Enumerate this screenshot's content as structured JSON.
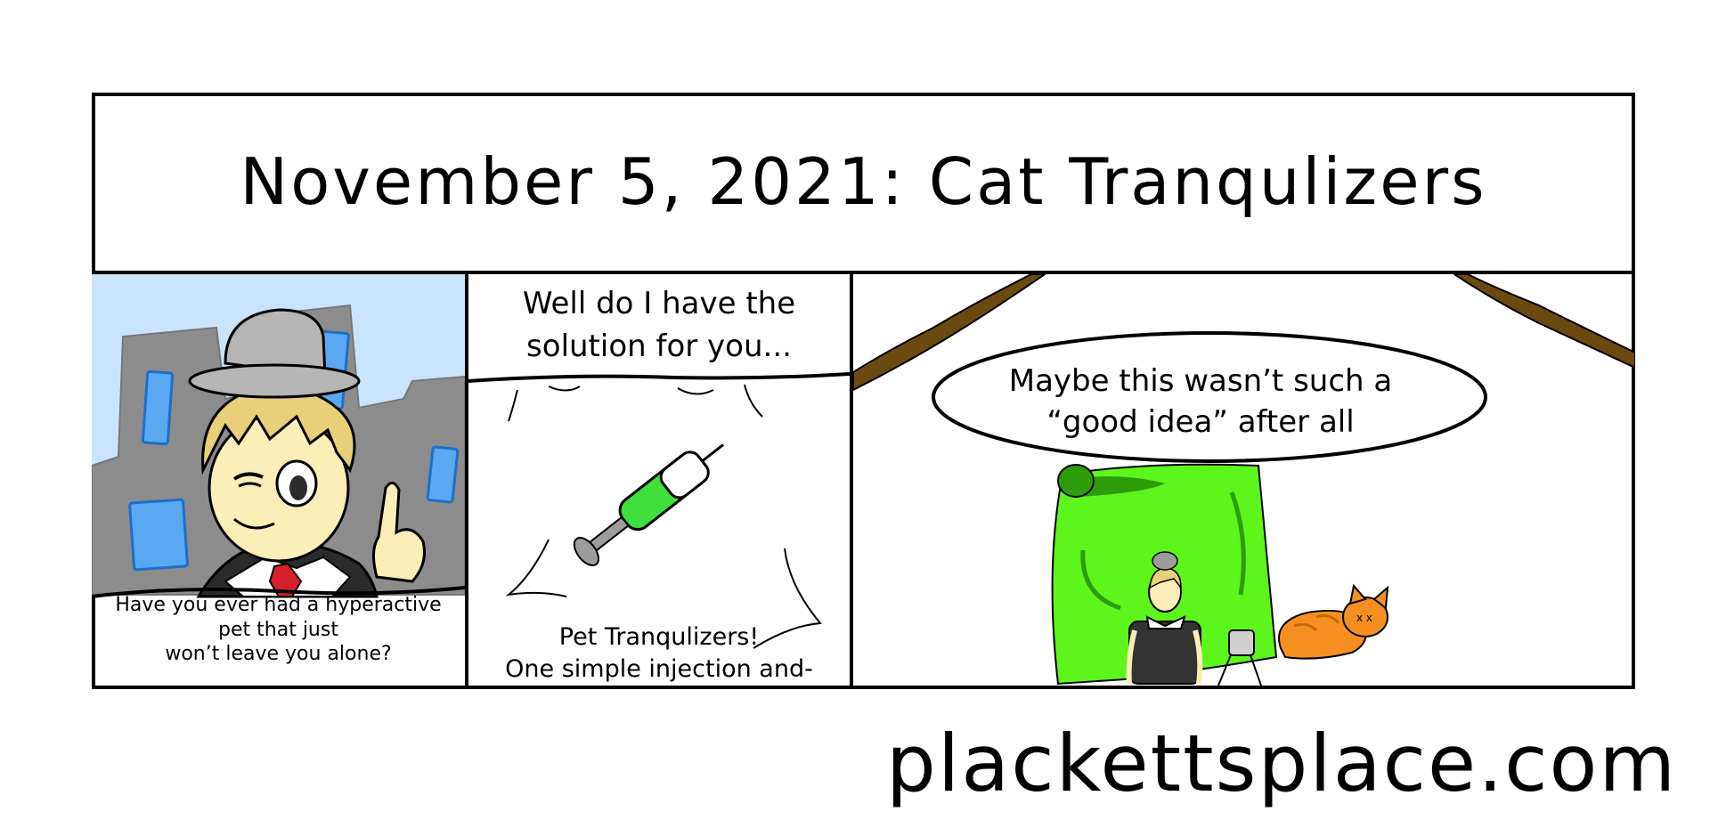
{
  "comic": {
    "title": "November 5, 2021: Cat Tranqulizers",
    "panel_1": {
      "caption_lines": [
        "Have you ever had a hyperactive",
        "pet that just",
        "won’t leave you alone?"
      ]
    },
    "panel_2": {
      "top_caption_lines": [
        "Well do I have the",
        "solution for you..."
      ],
      "bottom_caption_lines": [
        "Pet Tranqulizers!",
        "One simple injection and-"
      ]
    },
    "panel_3": {
      "bubble_lines": [
        "Maybe this wasn’t such a",
        "“good idea” after all"
      ]
    }
  },
  "footer": {
    "site": "plackettsplace.com"
  },
  "colors": {
    "sky": "#c9e3fa",
    "building": "#8c8c8c",
    "window": "#5aa7f2",
    "hat": "#b5b5b5",
    "hair": "#e8cf7a",
    "skin": "#fbefb8",
    "tie": "#d8202a",
    "syringe_fluid": "#3fe03b",
    "curtain": "#5df51b",
    "cat": "#f59020",
    "branch": "#6b4a10"
  }
}
